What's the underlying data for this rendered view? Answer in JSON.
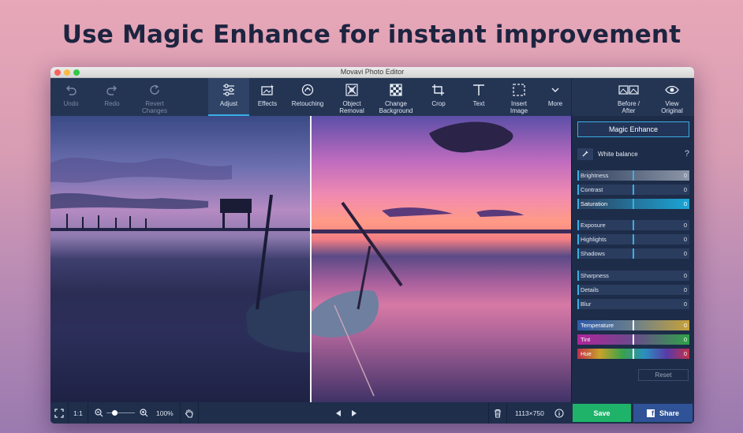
{
  "headline": "Use Magic Enhance for instant improvement",
  "window": {
    "title": "Movavi Photo Editor",
    "traffic_colors": [
      "#fc605c",
      "#fcbb40",
      "#34c84a"
    ]
  },
  "toolbar": {
    "undo": "Undo",
    "redo": "Redo",
    "revert": "Revert Changes",
    "adjust": "Adjust",
    "effects": "Effects",
    "retouching": "Retouching",
    "object_removal": "Object Removal",
    "change_background": "Change Background",
    "crop": "Crop",
    "text": "Text",
    "insert_image": "Insert Image",
    "more": "More",
    "before_after": "Before / After",
    "view_original": "View Original"
  },
  "panel": {
    "magic_enhance": "Magic Enhance",
    "white_balance": "White balance",
    "help": "?",
    "sliders": [
      {
        "name": "Brightness",
        "value": "0"
      },
      {
        "name": "Contrast",
        "value": "0"
      },
      {
        "name": "Saturation",
        "value": "0"
      },
      {
        "name": "Exposure",
        "value": "0"
      },
      {
        "name": "Highlights",
        "value": "0"
      },
      {
        "name": "Shadows",
        "value": "0"
      },
      {
        "name": "Sharpness",
        "value": "0"
      },
      {
        "name": "Details",
        "value": "0"
      },
      {
        "name": "Blur",
        "value": "0"
      },
      {
        "name": "Temperature",
        "value": "0"
      },
      {
        "name": "Tint",
        "value": "0"
      },
      {
        "name": "Hue",
        "value": "0"
      }
    ],
    "reset": "Reset"
  },
  "bottombar": {
    "ratio": "1:1",
    "zoom": "100%",
    "zoom_level": 0.25,
    "dimensions": "1113×750",
    "save": "Save",
    "share": "Share"
  },
  "colors": {
    "accent": "#3aaee6",
    "save_green": "#1fb36a",
    "share_blue": "#2f5396"
  }
}
